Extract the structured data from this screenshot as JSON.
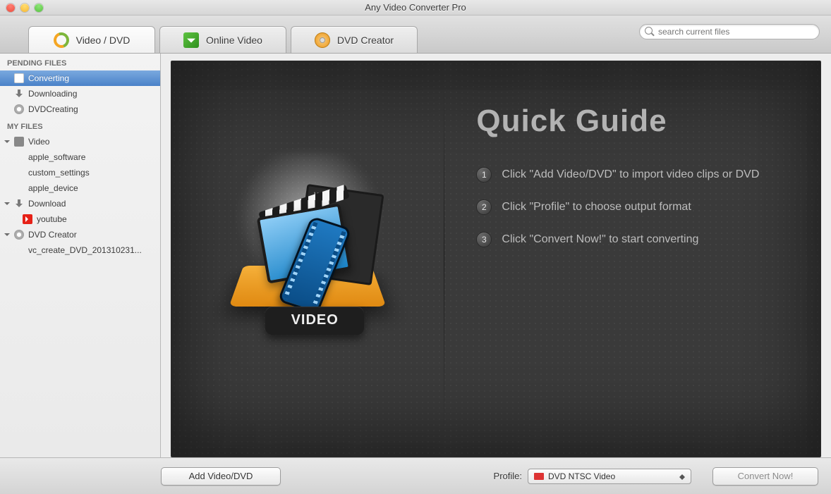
{
  "window": {
    "title": "Any Video Converter Pro"
  },
  "tabs": [
    {
      "label": "Video / DVD",
      "icon": "refresh-icon",
      "active": true
    },
    {
      "label": "Online Video",
      "icon": "download-icon",
      "active": false
    },
    {
      "label": "DVD Creator",
      "icon": "disc-icon",
      "active": false
    }
  ],
  "search": {
    "placeholder": "search current files"
  },
  "sidebar": {
    "pending_header": "PENDING FILES",
    "pending": [
      {
        "label": "Converting",
        "icon": "convert",
        "selected": true
      },
      {
        "label": "Downloading",
        "icon": "down",
        "selected": false
      },
      {
        "label": "DVDCreating",
        "icon": "dvd",
        "selected": false
      }
    ],
    "myfiles_header": "MY FILES",
    "groups": [
      {
        "label": "Video",
        "icon": "vid",
        "items": [
          "apple_software",
          "custom_settings",
          "apple_device"
        ]
      },
      {
        "label": "Download",
        "icon": "down",
        "items_icons": [
          {
            "label": "youtube",
            "icon": "yt"
          }
        ]
      },
      {
        "label": "DVD Creator",
        "icon": "dvd",
        "items": [
          "vc_create_DVD_201310231..."
        ]
      }
    ]
  },
  "guide": {
    "title": "Quick Guide",
    "art_label": "VIDEO",
    "steps": [
      "Click \"Add Video/DVD\" to import video clips or DVD",
      "Click \"Profile\" to choose output format",
      "Click \"Convert Now!\" to start converting"
    ]
  },
  "bottom": {
    "add_label": "Add Video/DVD",
    "profile_label": "Profile:",
    "profile_value": "DVD NTSC Video",
    "convert_label": "Convert Now!"
  }
}
